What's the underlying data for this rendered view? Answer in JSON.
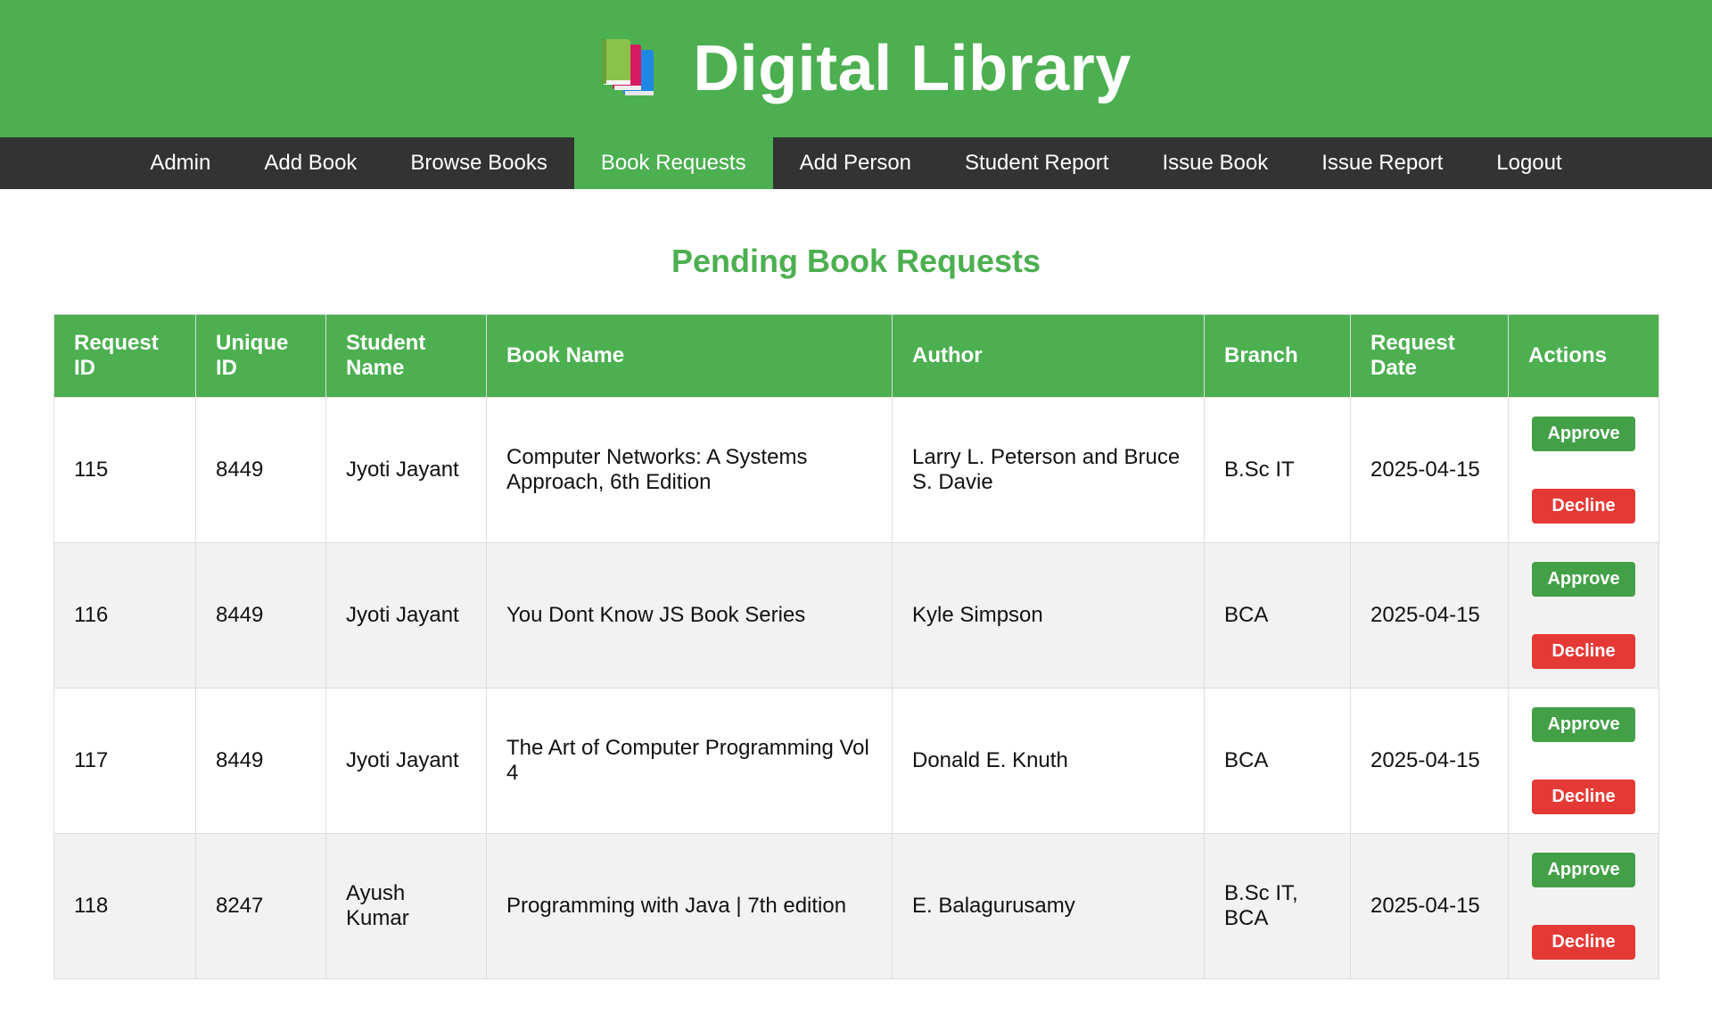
{
  "header": {
    "title": "Digital Library",
    "logo_icon": "books-icon"
  },
  "nav": {
    "items": [
      {
        "label": "Admin"
      },
      {
        "label": "Add Book"
      },
      {
        "label": "Browse Books"
      },
      {
        "label": "Book Requests",
        "active": true
      },
      {
        "label": "Add Person"
      },
      {
        "label": "Student Report"
      },
      {
        "label": "Issue Book"
      },
      {
        "label": "Issue Report"
      },
      {
        "label": "Logout"
      }
    ]
  },
  "main": {
    "title": "Pending Book Requests",
    "table": {
      "headers": [
        "Request ID",
        "Unique ID",
        "Student Name",
        "Book Name",
        "Author",
        "Branch",
        "Request Date",
        "Actions"
      ],
      "rows": [
        {
          "request_id": "115",
          "unique_id": "8449",
          "student_name": "Jyoti Jayant",
          "book_name": "Computer Networks: A Systems Approach, 6th Edition",
          "author": "Larry L. Peterson and Bruce S. Davie",
          "branch": "B.Sc IT",
          "request_date": "2025-04-15"
        },
        {
          "request_id": "116",
          "unique_id": "8449",
          "student_name": "Jyoti Jayant",
          "book_name": "You Dont Know JS Book Series",
          "author": "Kyle Simpson",
          "branch": "BCA",
          "request_date": "2025-04-15"
        },
        {
          "request_id": "117",
          "unique_id": "8449",
          "student_name": "Jyoti Jayant",
          "book_name": "The Art of Computer Programming Vol 4",
          "author": "Donald E. Knuth",
          "branch": "BCA",
          "request_date": "2025-04-15"
        },
        {
          "request_id": "118",
          "unique_id": "8247",
          "student_name": "Ayush Kumar",
          "book_name": "Programming with Java | 7th edition",
          "author": "E. Balagurusamy",
          "branch": "B.Sc IT, BCA",
          "request_date": "2025-04-15"
        }
      ],
      "approve_label": "Approve",
      "decline_label": "Decline"
    }
  },
  "colors": {
    "primary": "#4CAF50",
    "nav_bg": "#333333",
    "approve": "#43A047",
    "decline": "#E53935",
    "row_alt": "#f2f2f2"
  }
}
